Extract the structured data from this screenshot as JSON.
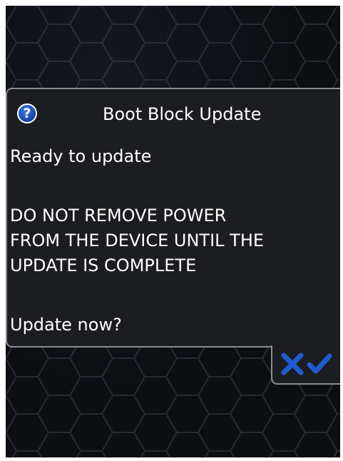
{
  "dialog": {
    "title": "Boot Block Update",
    "help_icon_glyph": "?",
    "icon": "question-icon",
    "accent_color": "#1f5bd1",
    "lines": {
      "ready": "Ready to update",
      "warning_1": "DO NOT REMOVE POWER",
      "warning_2": "FROM THE DEVICE UNTIL THE",
      "warning_3": "UPDATE IS COMPLETE",
      "prompt": "Update now?"
    }
  },
  "buttons": {
    "cancel": {
      "icon": "close-icon",
      "color": "#1f5bd1"
    },
    "confirm": {
      "icon": "check-icon",
      "color": "#1f5bd1"
    }
  }
}
